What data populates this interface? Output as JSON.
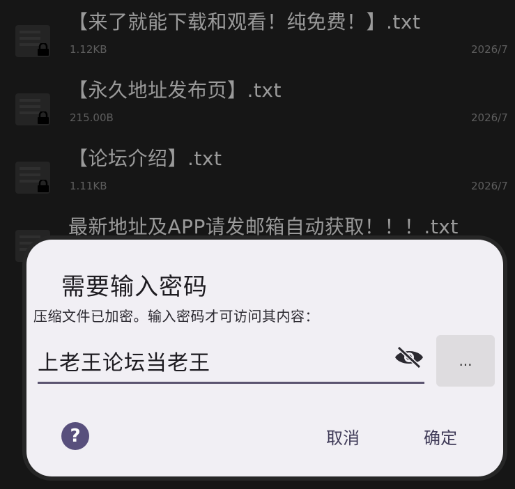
{
  "files": [
    {
      "name": "【来了就能下载和观看！纯免费！】.txt",
      "size": "1.12KB",
      "date": "2026/7"
    },
    {
      "name": "【永久地址发布页】.txt",
      "size": "215.00B",
      "date": "2026/7"
    },
    {
      "name": "【论坛介绍】.txt",
      "size": "1.11KB",
      "date": "2026/7"
    },
    {
      "name": "最新地址及APP请发邮箱自动获取！！！.txt",
      "size": "",
      "date": ""
    }
  ],
  "dialog": {
    "title": "需要输入密码",
    "message": "压缩文件已加密。输入密码才可访问其内容：",
    "password_value": "上老王论坛当老王",
    "more_label": "...",
    "help_label": "?",
    "cancel_label": "取消",
    "confirm_label": "确定",
    "accent_color": "#584f7c"
  }
}
